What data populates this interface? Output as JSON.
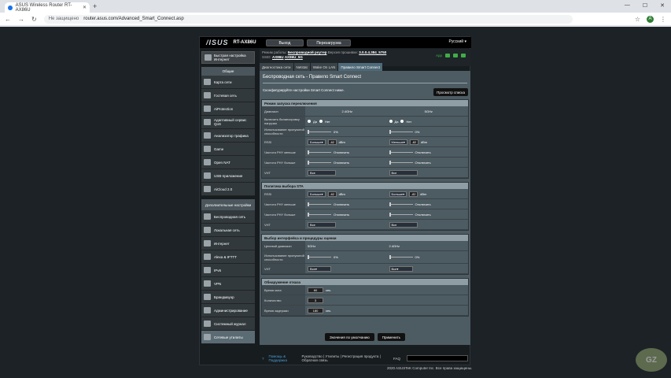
{
  "browser": {
    "tab_title": "ASUS Wireless Router RT-AX86U",
    "not_secure": "Не защищено",
    "url": "router.asus.com/Advanced_Smart_Connect.asp",
    "avatar": "А"
  },
  "header": {
    "logo": "/ISUS",
    "model": "RT-AX86U",
    "logout": "Выход",
    "reboot": "Перезагрузка",
    "language": "Русский"
  },
  "info": {
    "mode_label": "Режим работы:",
    "mode_value": "Беспроводной роутер",
    "fw_label": "Версия прошивки:",
    "fw_value": "3.0.0.4.384_5750",
    "ssid_label": "SSID:",
    "ssid1": "AX86U",
    "ssid2": "AX86U_5G",
    "app": "App"
  },
  "sidebar": {
    "quick": "Быстрая настройка Интернет",
    "general": "Общие",
    "items": [
      "Карта сети",
      "Гостевая сеть",
      "AiProtection",
      "Адаптивный сервис QoS",
      "Анализатор трафика",
      "Game",
      "Open NAT",
      "USB-приложение",
      "AiCloud 2.0"
    ],
    "advanced": "Дополнительные настройки",
    "adv_items": [
      "Беспроводная сеть",
      "Локальная сеть",
      "Интернет",
      "Alexa & IFTTT",
      "IPv6",
      "VPN",
      "Брандмауэр",
      "Администрирование",
      "Системный журнал",
      "Сетевые утилиты"
    ]
  },
  "tabs": [
    "Диагностика сети",
    "Netstat",
    "Wake On LAN",
    "Правило Smart Connect"
  ],
  "main": {
    "title": "Беспроводная сеть - Правило Smart Connect",
    "desc": "Сконфигурируйте настройки Smart Connect ниже.",
    "preview": "Просмотр списка"
  },
  "sec1": {
    "title": "Режим запуска переключения",
    "band_label": "Диапазон",
    "band24": "2.4GHz",
    "band5": "5GHz",
    "load_label": "Включить балансировку нагрузки",
    "yes": "Да",
    "no": "Нет",
    "bw_label": "Использование пропускной способности",
    "pct": "0%",
    "rssi": "RSSI",
    "more": "Больше",
    "less": "Меньше",
    "rssi_val": "-62",
    "dbm": "dBm",
    "phy_low": "Частота PHY меньше",
    "phy_high": "Частота PHY больше",
    "off": "Отключить",
    "vht": "VHT",
    "all": "Все"
  },
  "sec2": {
    "title": "Политика выбора STA",
    "rssi": "RSSI",
    "more": "Больше",
    "rssi_val": "-82",
    "dbm": "dBm",
    "phy_low": "Частота PHY меньше",
    "phy_high": "Частота PHY больше",
    "off": "Отключить",
    "vht": "VHT",
    "all": "Все"
  },
  "sec3": {
    "title": "Выбор интерфейса и процедуры оценки",
    "target_label": "Целевой диапазон",
    "t1": "5GHz",
    "t2": "2.4GHz",
    "bw_label": "Использование пропускной способности",
    "pct": "0%",
    "vht": "VHT",
    "all": "Все"
  },
  "sec4": {
    "title": "Обнаружение отказа",
    "window_label": "Время окна",
    "window_val": "60",
    "sec": "сек.",
    "count_label": "Количество",
    "count_val": "3",
    "delay_label": "Время задержки",
    "delay_val": "180"
  },
  "actions": {
    "default": "Значения по умолчанию",
    "apply": "Применить"
  },
  "footer": {
    "help": "Помощь & Поддержка",
    "links": "Руководство | Утилиты | Регистрация продукта | Обратная связь",
    "faq": "FAQ",
    "copyright": "2020 ASUSTeK Computer Inc. Все права защищены."
  },
  "watermark": "GZ"
}
